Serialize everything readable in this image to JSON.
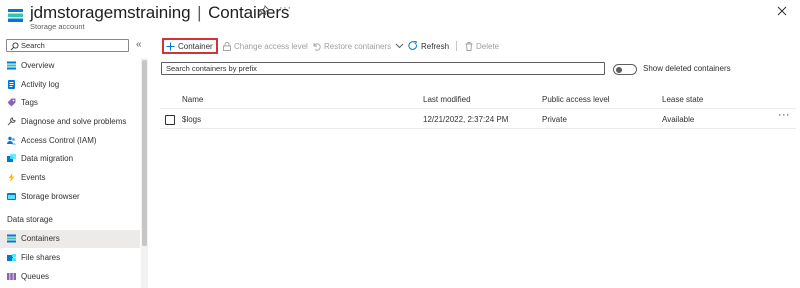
{
  "header": {
    "resource_name": "jdmstoragemstraining",
    "separator": "|",
    "page_name": "Containers",
    "subtitle": "Storage account",
    "more_label": "···"
  },
  "sidebar": {
    "search_placeholder": "Search",
    "collapse_label": "«",
    "items": [
      {
        "label": "Overview",
        "icon": "storage-overview-icon",
        "color": "#0078d4"
      },
      {
        "label": "Activity log",
        "icon": "activity-log-icon",
        "color": "#0078d4"
      },
      {
        "label": "Tags",
        "icon": "tag-icon",
        "color": "#8764b8"
      },
      {
        "label": "Diagnose and solve problems",
        "icon": "wrench-icon",
        "color": "#605e5c"
      },
      {
        "label": "Access Control (IAM)",
        "icon": "people-icon",
        "color": "#0078d4"
      },
      {
        "label": "Data migration",
        "icon": "migration-icon",
        "color": "#0078d4"
      },
      {
        "label": "Events",
        "icon": "lightning-icon",
        "color": "#ffb900"
      },
      {
        "label": "Storage browser",
        "icon": "storage-browser-icon",
        "color": "#0078d4"
      }
    ],
    "section_data_storage": "Data storage",
    "data_items": [
      {
        "label": "Containers",
        "icon": "containers-icon",
        "color": "#0078d4",
        "active": true
      },
      {
        "label": "File shares",
        "icon": "file-shares-icon",
        "color": "#0078d4"
      },
      {
        "label": "Queues",
        "icon": "queues-icon",
        "color": "#8764b8"
      }
    ]
  },
  "toolbar": {
    "add_container": "Container",
    "change_access": "Change access level",
    "restore_containers": "Restore containers",
    "refresh": "Refresh",
    "delete": "Delete"
  },
  "filter": {
    "placeholder": "Search containers by prefix",
    "toggle_label": "Show deleted containers",
    "toggle_on": false
  },
  "table": {
    "headers": [
      "Name",
      "Last modified",
      "Public access level",
      "Lease state"
    ],
    "rows": [
      {
        "name": "$logs",
        "last_modified": "12/21/2022, 2:37:24 PM",
        "access": "Private",
        "lease": "Available"
      }
    ],
    "row_more": "···"
  },
  "colors": {
    "accent": "#0078d4",
    "highlight_border": "#d13438",
    "disabled_text": "#a19f9d"
  }
}
